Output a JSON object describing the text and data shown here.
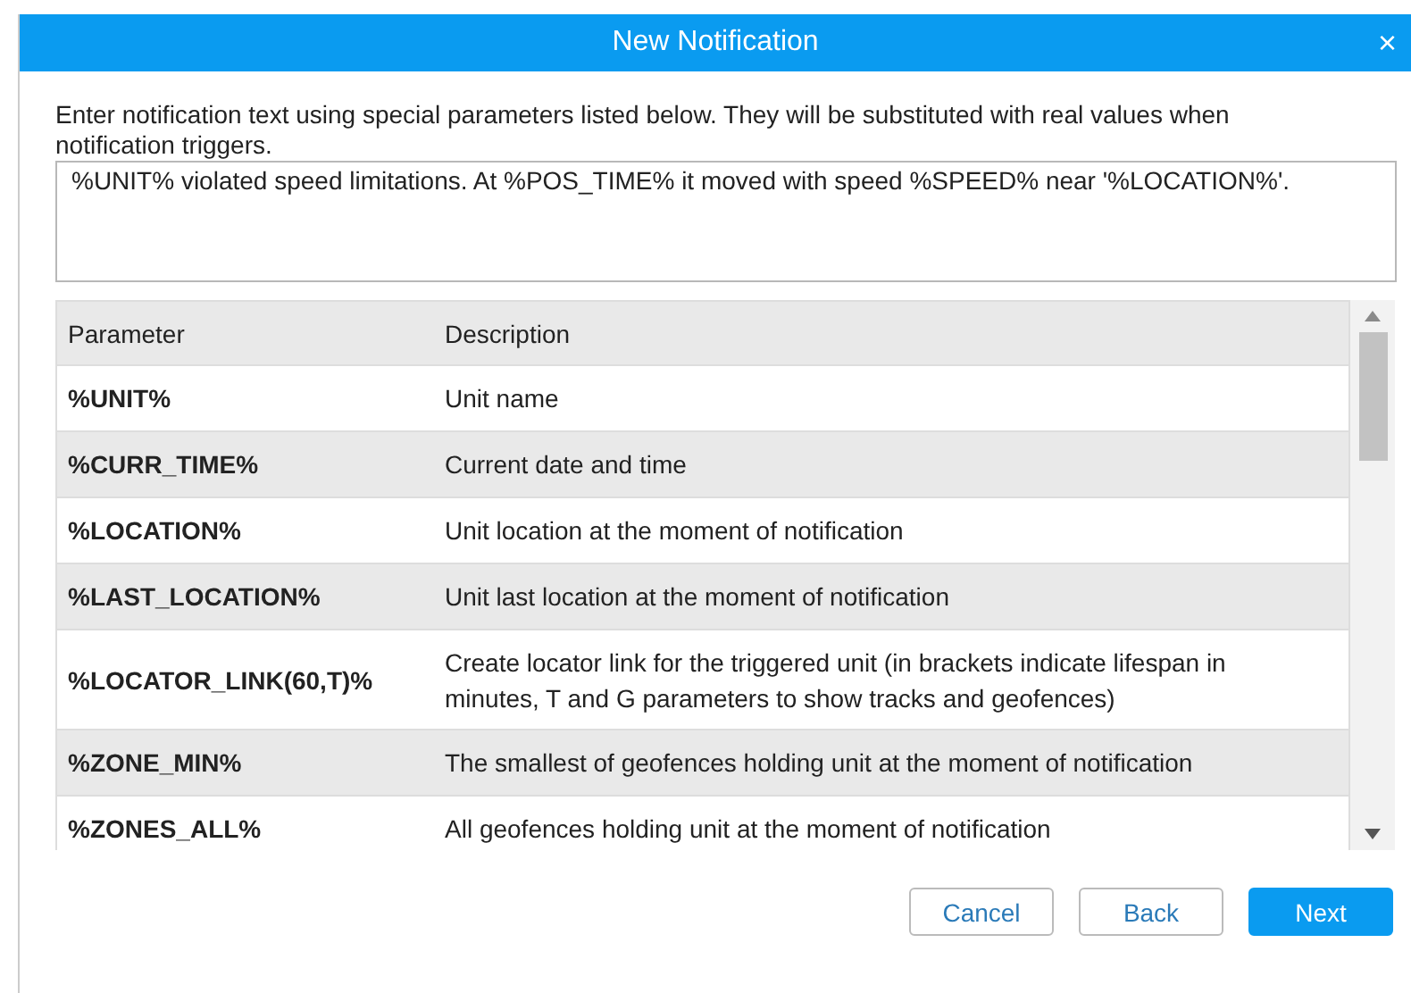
{
  "window": {
    "title": "New Notification",
    "close": "×"
  },
  "instructions": "Enter notification text using special parameters listed below. They will be substituted with real values when notification triggers.",
  "message": {
    "value": "%UNIT% violated speed limitations. At %POS_TIME% it moved with speed %SPEED% near '%LOCATION%'."
  },
  "table": {
    "columns": [
      "Parameter",
      "Description"
    ],
    "rows": [
      {
        "parameter": "%UNIT%",
        "description": "Unit name"
      },
      {
        "parameter": "%CURR_TIME%",
        "description": "Current date and time"
      },
      {
        "parameter": "%LOCATION%",
        "description": "Unit location at the moment of notification"
      },
      {
        "parameter": "%LAST_LOCATION%",
        "description": "Unit last location at the moment of notification"
      },
      {
        "parameter": "%LOCATOR_LINK(60,T)%",
        "description": "Create locator link for the triggered unit (in brackets indicate lifespan in minutes, T and G parameters to show tracks and geofences)"
      },
      {
        "parameter": "%ZONE_MIN%",
        "description": "The smallest of geofences holding unit at the moment of notification"
      },
      {
        "parameter": "%ZONES_ALL%",
        "description": "All geofences holding unit at the moment of notification"
      }
    ]
  },
  "buttons": [
    {
      "label": "Cancel",
      "kind": "secondary"
    },
    {
      "label": "Back",
      "kind": "secondary"
    },
    {
      "label": "Next",
      "kind": "primary"
    }
  ]
}
